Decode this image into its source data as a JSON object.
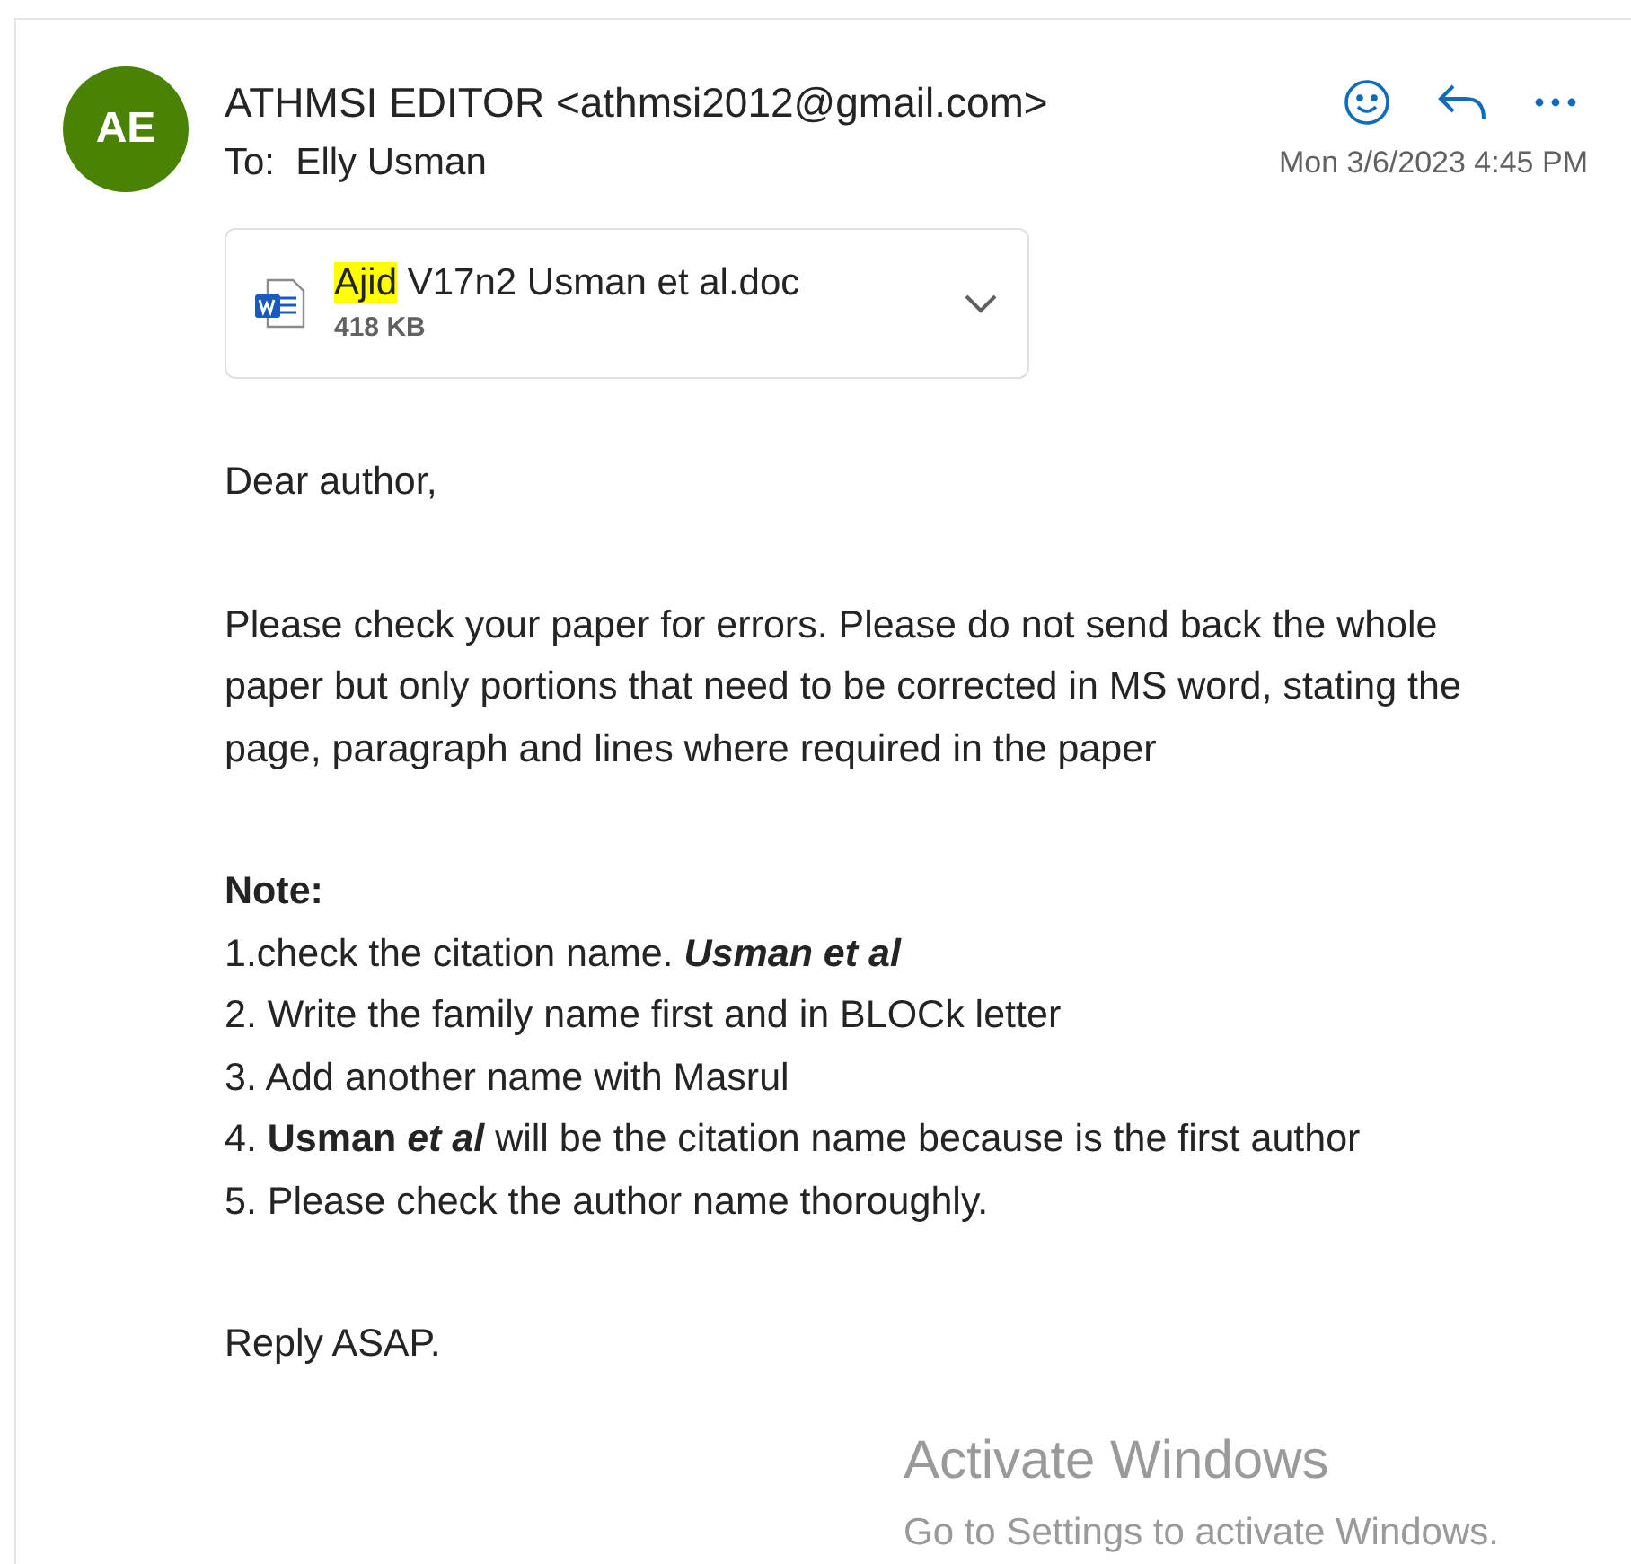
{
  "sender": {
    "initials": "AE",
    "name": "ATHMSI EDITOR <athmsi2012@gmail.com>",
    "to_label": "To:",
    "to": "Elly Usman",
    "date": "Mon 3/6/2023 4:45 PM"
  },
  "attachment": {
    "name_highlighted": "Ajid",
    "name_rest": " V17n2 Usman et al.doc",
    "size": "418 KB"
  },
  "body": [
    {
      "kind": "para",
      "text": "Dear author,"
    },
    {
      "kind": "para",
      "text": "Please check your paper for errors. Please do not send back the whole paper but only portions that need to be corrected in MS word, stating the page, paragraph and lines where required in the paper"
    },
    {
      "kind": "heading",
      "text": "Note:"
    },
    {
      "kind": "line",
      "text": "1.check the citation name. ",
      "emphasis": "Usman et al"
    },
    {
      "kind": "line",
      "text": "2. Write the family name first and in BLOCk letter"
    },
    {
      "kind": "line",
      "text": "3. Add another name with Masrul"
    },
    {
      "kind": "line",
      "text": "4. **Usman** ",
      "emphasis": "et al",
      "after": " will be the citation name because is the first author"
    },
    {
      "kind": "line",
      "text": "5. Please check the author name thoroughly."
    },
    {
      "kind": "para",
      "text": "Reply ASAP."
    }
  ],
  "os_notice": {
    "title": "Activate Windows",
    "subtitle": "Go to Settings to activate Windows."
  }
}
